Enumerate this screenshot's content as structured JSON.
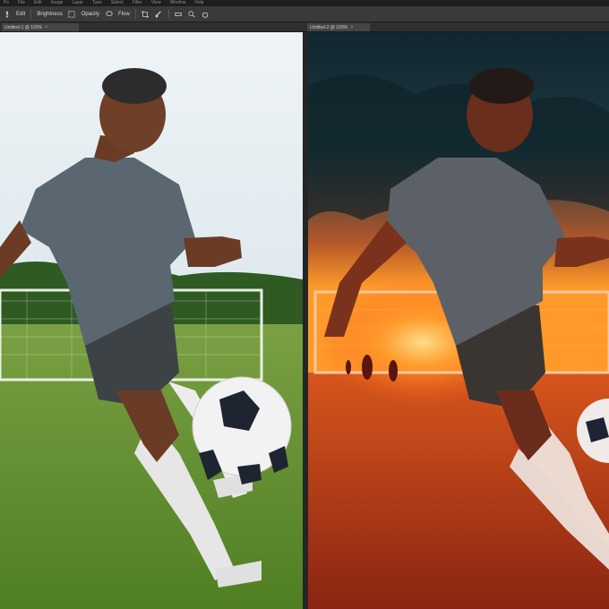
{
  "menu": {
    "items": [
      "Ps",
      "File",
      "Edit",
      "Image",
      "Layer",
      "Type",
      "Select",
      "Filter",
      "View",
      "Window",
      "Help"
    ]
  },
  "options": {
    "tool_label": "Edit",
    "mode_label": "Brightness",
    "field_a": "Opacity",
    "field_b": "Flow"
  },
  "tabs": {
    "left": "Untitled-1 @ 100%",
    "right": "Untitled-2 @ 100%"
  },
  "colors": {
    "app_bg": "#2b2b2b",
    "toolbar_bg": "#3a3a3a",
    "tab_bg": "#454545",
    "sky_left": "#dfe9ee",
    "grass_left": "#5f8d2c",
    "sky_right_top": "#1b3a44",
    "sunset_glow": "#ff9a2a",
    "field_right": "#b5361a"
  },
  "icons": [
    "move-icon",
    "marquee-icon",
    "lasso-icon",
    "crop-icon",
    "brush-icon",
    "eraser-icon",
    "zoom-icon",
    "hand-icon"
  ]
}
